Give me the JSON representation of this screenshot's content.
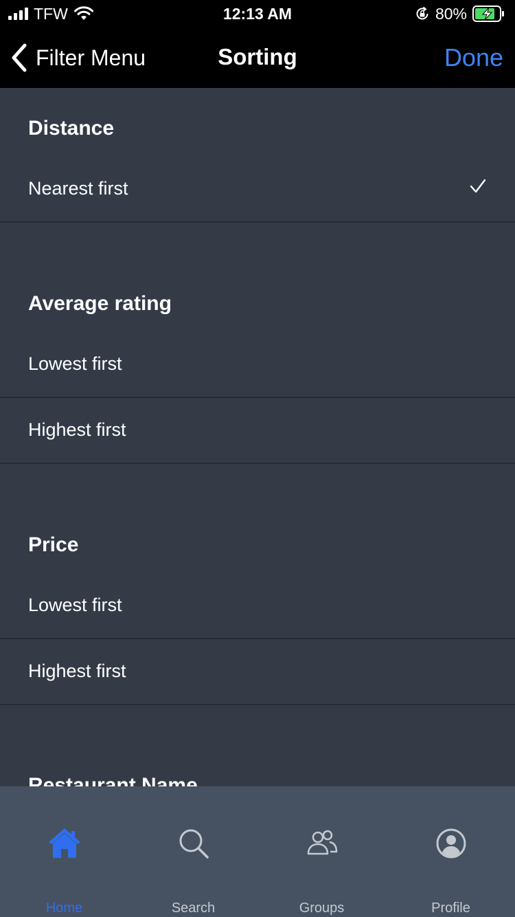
{
  "status_bar": {
    "carrier": "TFW",
    "time": "12:13 AM",
    "battery": "80%"
  },
  "nav": {
    "back_label": "Filter Menu",
    "title": "Sorting",
    "done_label": "Done"
  },
  "sections": [
    {
      "header": "Distance",
      "options": [
        {
          "label": "Nearest first",
          "selected": true
        }
      ]
    },
    {
      "header": "Average rating",
      "options": [
        {
          "label": "Lowest first"
        },
        {
          "label": "Highest first"
        }
      ]
    },
    {
      "header": "Price",
      "options": [
        {
          "label": "Lowest first"
        },
        {
          "label": "Highest first"
        }
      ]
    },
    {
      "header": "Restaurant Name",
      "options": []
    }
  ],
  "tabs": [
    {
      "label": "Home",
      "icon": "home-icon",
      "active": true
    },
    {
      "label": "Search",
      "icon": "search-icon"
    },
    {
      "label": "Groups",
      "icon": "groups-icon"
    },
    {
      "label": "Profile",
      "icon": "profile-icon"
    }
  ],
  "colors": {
    "accent": "#3d84f5",
    "background": "#343b47",
    "tab_bar": "#465262",
    "nav_bar": "#000000"
  }
}
